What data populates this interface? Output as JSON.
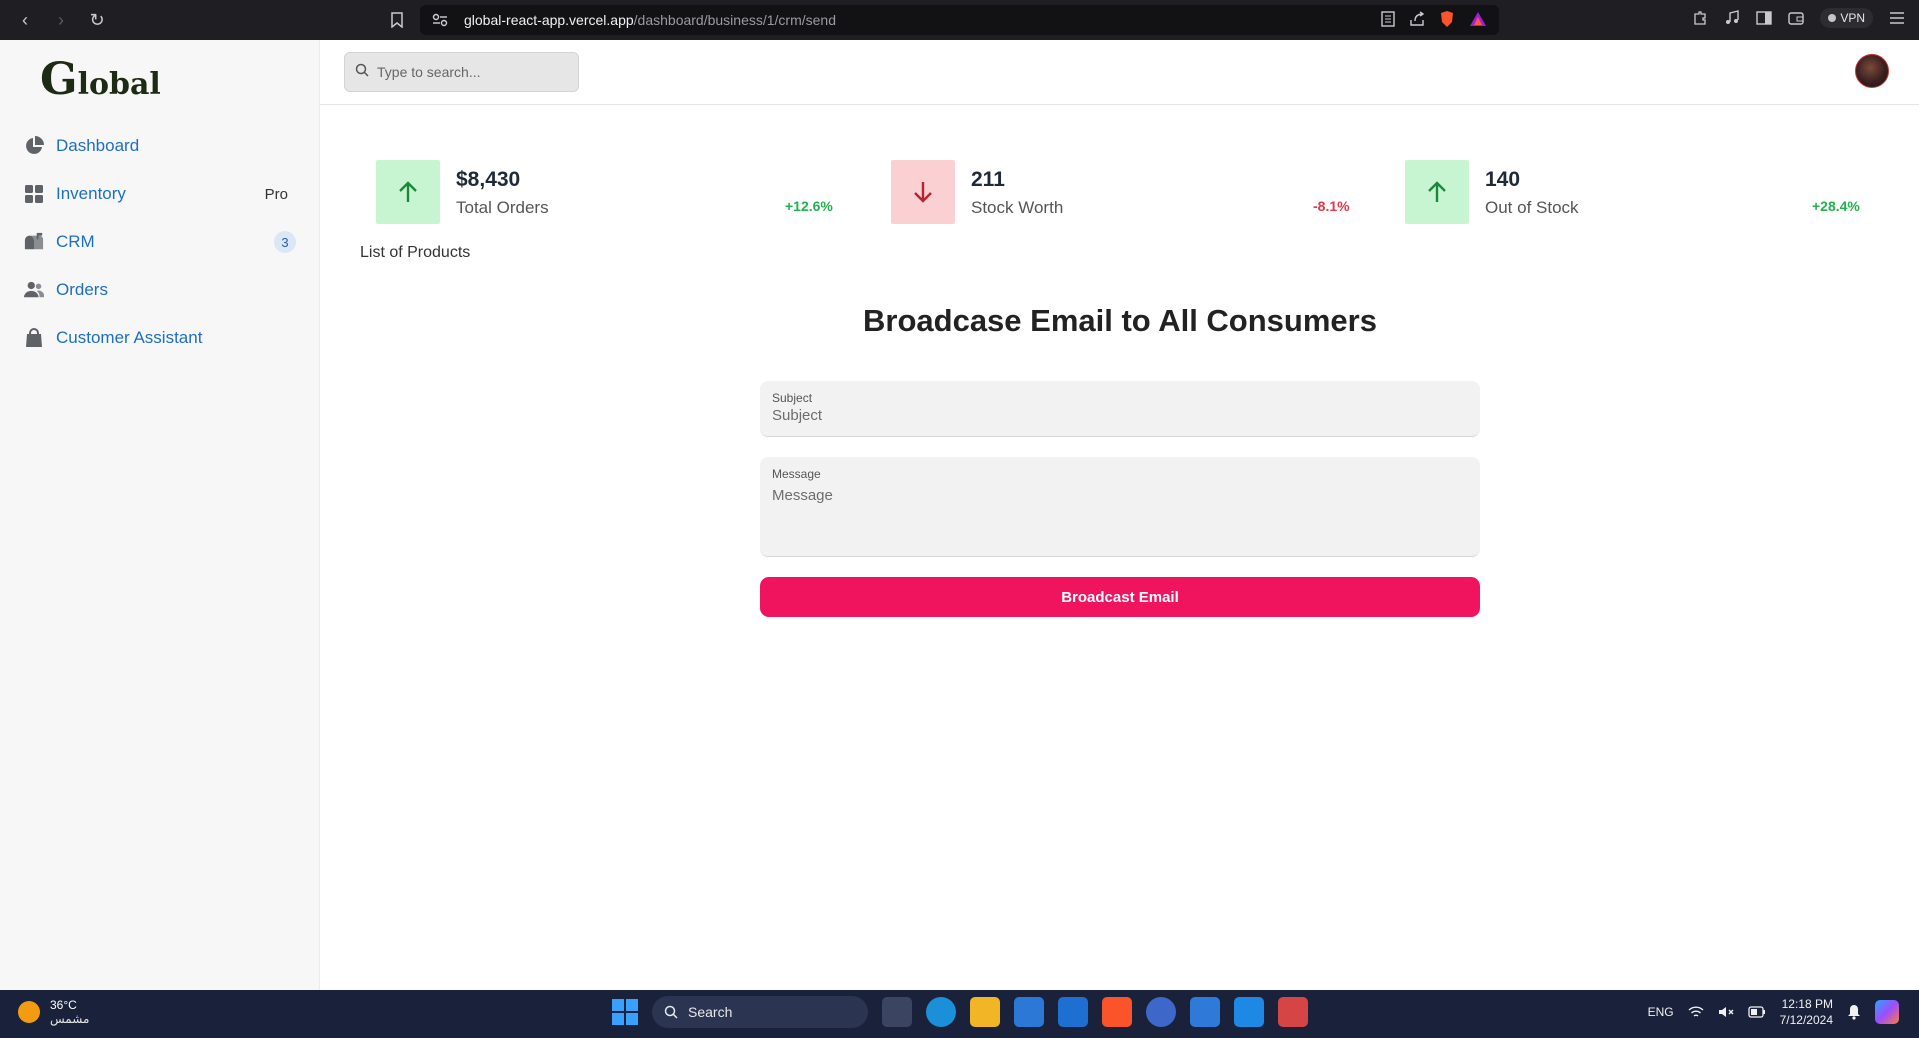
{
  "browser": {
    "url_host": "global-react-app.vercel.app",
    "url_path": "/dashboard/business/1/crm/send",
    "vpn_label": "VPN"
  },
  "sidebar": {
    "logo_first": "G",
    "logo_rest": "lobal",
    "items": [
      {
        "label": "Dashboard",
        "icon": "pie-chart-icon"
      },
      {
        "label": "Inventory",
        "icon": "grid-icon",
        "badge": "Pro"
      },
      {
        "label": "CRM",
        "icon": "mailbox-icon",
        "count": "3"
      },
      {
        "label": "Orders",
        "icon": "users-icon"
      },
      {
        "label": "Customer Assistant",
        "icon": "shopping-bag-icon"
      }
    ]
  },
  "topbar": {
    "search_placeholder": "Type to search..."
  },
  "stats": [
    {
      "value": "$8,430",
      "label": "Total Orders",
      "change": "+12.6%",
      "direction": "up"
    },
    {
      "value": "211",
      "label": "Stock Worth",
      "change": "-8.1%",
      "direction": "down"
    },
    {
      "value": "140",
      "label": "Out of Stock",
      "change": "+28.4%",
      "direction": "up"
    }
  ],
  "list_title": "List of Products",
  "form": {
    "title": "Broadcase Email to All Consumers",
    "subject_label": "Subject",
    "subject_placeholder": "Subject",
    "message_label": "Message",
    "message_placeholder": "Message",
    "submit_label": "Broadcast Email"
  },
  "colors": {
    "accent": "#f0145f",
    "link": "#1f6fc1",
    "positive": "#22b24c",
    "negative": "#e0394b"
  },
  "taskbar": {
    "temperature": "36°C",
    "weather_text": "مشمس",
    "search_label": "Search",
    "language": "ENG",
    "time": "12:18 PM",
    "date": "7/12/2024"
  }
}
